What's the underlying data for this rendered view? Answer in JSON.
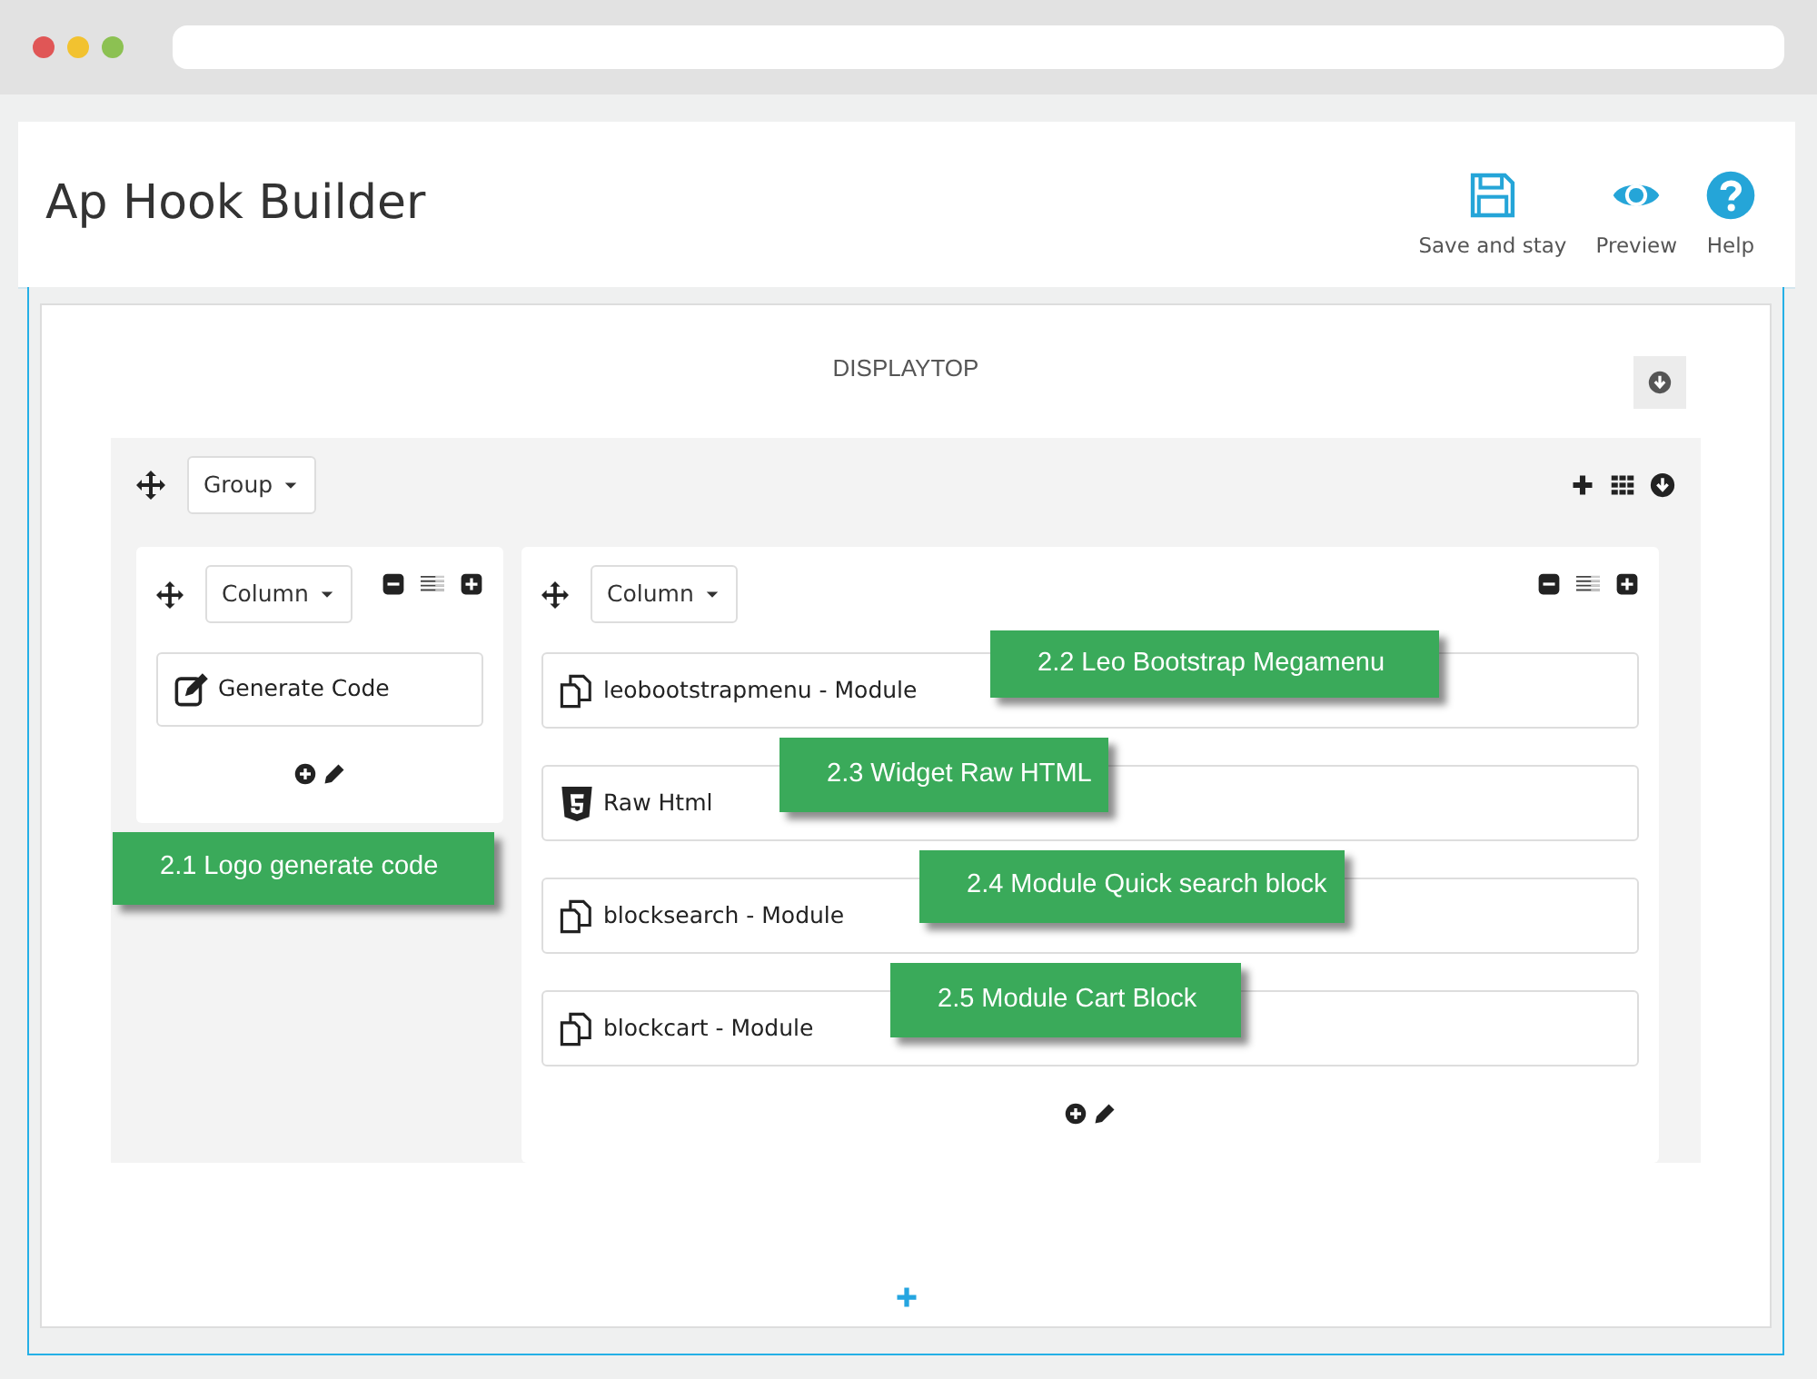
{
  "page_title": "Ap Hook Builder",
  "toolbar": [
    {
      "kind": "save",
      "label": "Save and stay"
    },
    {
      "kind": "preview",
      "label": "Preview"
    },
    {
      "kind": "help",
      "label": "Help"
    }
  ],
  "hook": {
    "name": "DISPLAYTOP"
  },
  "group": {
    "label": "Group"
  },
  "columns": [
    {
      "label": "Column",
      "widgets": [
        {
          "kind": "code",
          "label": "Generate Code"
        }
      ]
    },
    {
      "label": "Column",
      "widgets": [
        {
          "kind": "module",
          "label": "leobootstrapmenu - Module"
        },
        {
          "kind": "html",
          "label": "Raw Html"
        },
        {
          "kind": "module",
          "label": "blocksearch - Module"
        },
        {
          "kind": "module",
          "label": "blockcart - Module"
        }
      ]
    }
  ],
  "annotations": [
    {
      "text": "2.1 Logo generate code"
    },
    {
      "text": "2.2 Leo Bootstrap Megamenu"
    },
    {
      "text": "2.3 Widget Raw HTML"
    },
    {
      "text": "2.4 Module Quick search block"
    },
    {
      "text": "2.5 Module Cart Block"
    }
  ]
}
